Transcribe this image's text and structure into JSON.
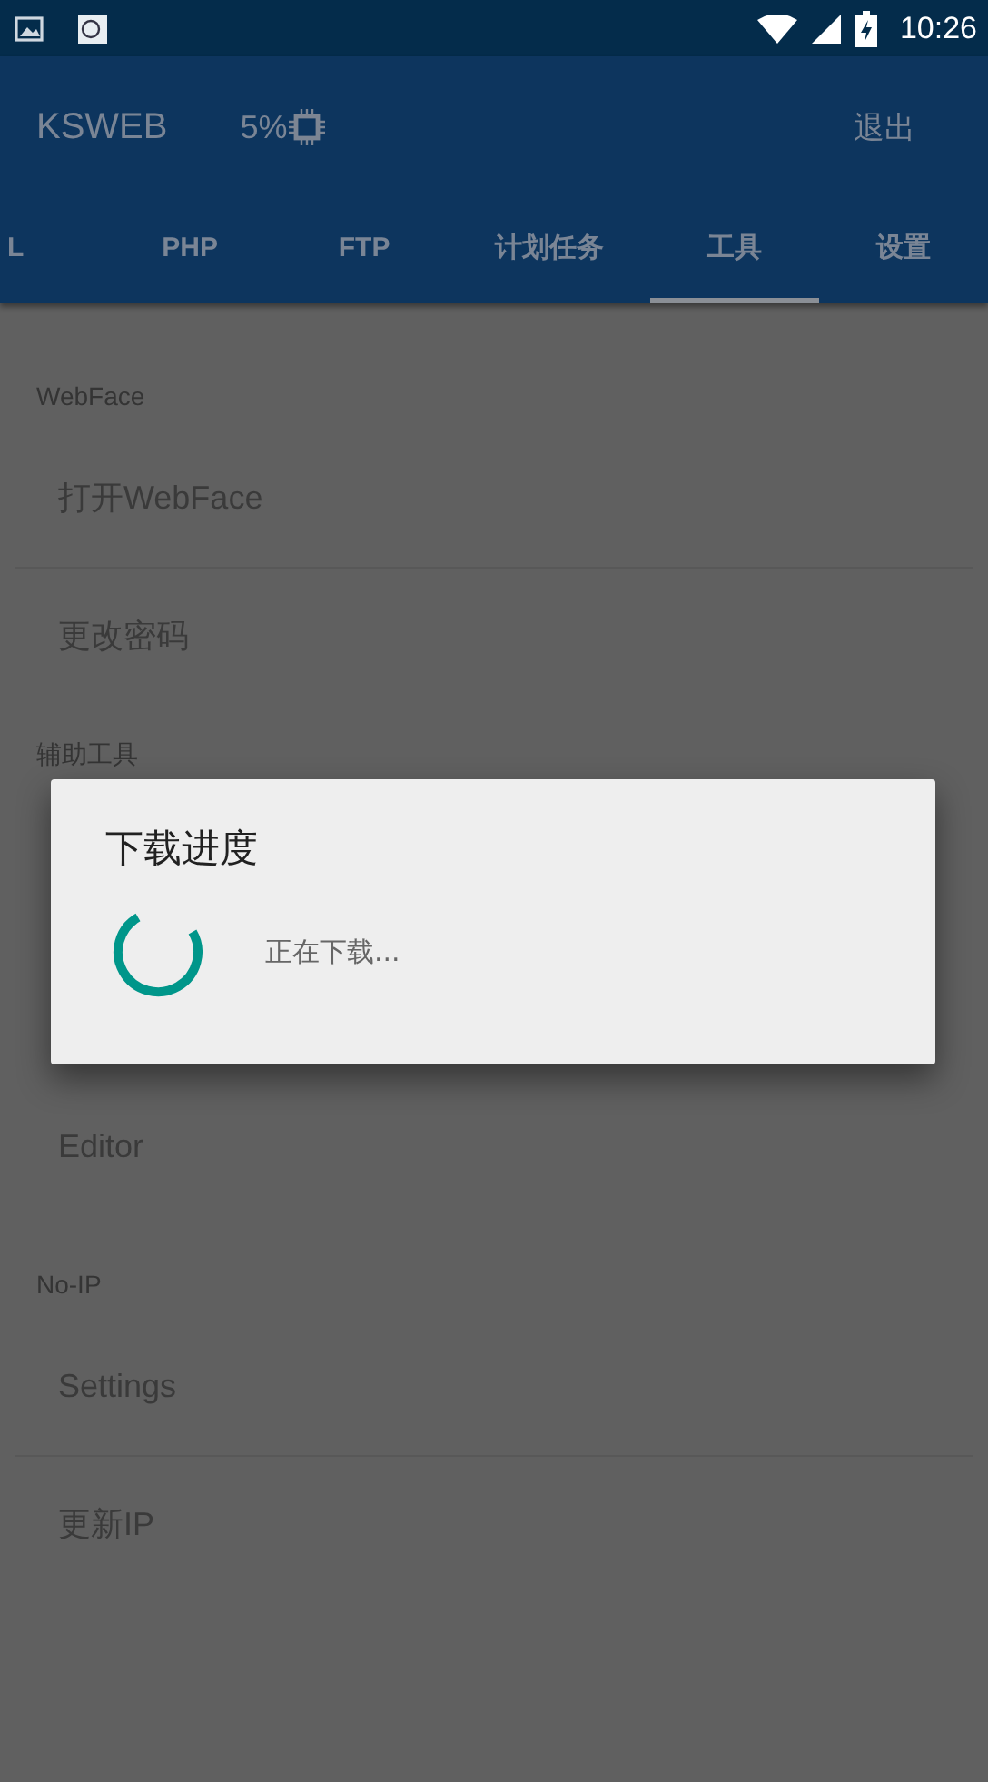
{
  "status_bar": {
    "time": "10:26"
  },
  "app_bar": {
    "title": "KSWEB",
    "cpu": "5%",
    "action": "退出"
  },
  "tabs": [
    {
      "label": "L",
      "selected": false
    },
    {
      "label": "PHP",
      "selected": false
    },
    {
      "label": "FTP",
      "selected": false
    },
    {
      "label": "计划任务",
      "selected": false
    },
    {
      "label": "工具",
      "selected": true
    },
    {
      "label": "设置",
      "selected": false
    }
  ],
  "sections": [
    {
      "header": "WebFace",
      "items": [
        "打开WebFace",
        "更改密码"
      ]
    },
    {
      "header": "辅助工具",
      "items": [
        "Editor"
      ]
    },
    {
      "header": "No-IP",
      "items": [
        "Settings",
        "更新IP"
      ]
    }
  ],
  "dialog": {
    "title": "下载进度",
    "message": "正在下载..."
  }
}
